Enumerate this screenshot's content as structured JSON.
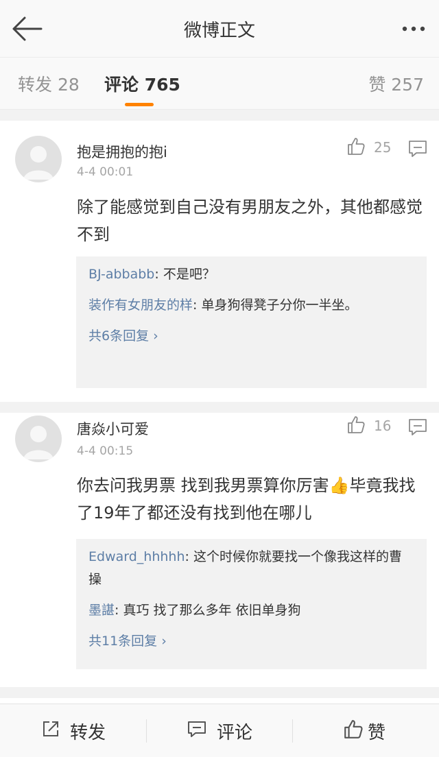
{
  "header": {
    "title": "微博正文"
  },
  "tabs": {
    "reposts": "转发 28",
    "comments": "评论 765",
    "likes": "赞 257"
  },
  "comments": [
    {
      "author": "抱是拥抱的抱i",
      "time": "4-4 00:01",
      "likes": "25",
      "text": "除了能感觉到自己没有男朋友之外，其他都感觉不到",
      "replies": [
        {
          "user": "BJ-abbabb",
          "sep": ": ",
          "text": "不是吧？"
        },
        {
          "user": "装作有女朋友的样",
          "sep": ": ",
          "text": "单身狗得凳子分你一半坐。"
        }
      ],
      "more": "共6条回复 ›"
    },
    {
      "author": "唐焱小可爱",
      "time": "4-4 00:15",
      "likes": "16",
      "text": "你去问我男票 找到我男票算你厉害👍毕竟我找了19年了都还没有找到他在哪儿",
      "replies": [
        {
          "user": "Edward_hhhhh",
          "sep": ": ",
          "text": "这个时候你就要找一个像我这样的曹操"
        },
        {
          "user": "墨諶",
          "sep": ": ",
          "text": "真巧 找了那么多年 依旧单身狗"
        }
      ],
      "more": "共11条回复 ›"
    }
  ],
  "bottom_bar": {
    "repost": "转发",
    "comment": "评论",
    "like": "赞"
  },
  "colors": {
    "accent": "#ff8200",
    "link": "#5d7ea6",
    "muted": "#a5a5a5"
  },
  "icons": [
    "back-arrow-icon",
    "more-dots-icon",
    "thumbs-up-icon",
    "reply-icon",
    "repost-icon",
    "comment-icon",
    "like-icon"
  ]
}
